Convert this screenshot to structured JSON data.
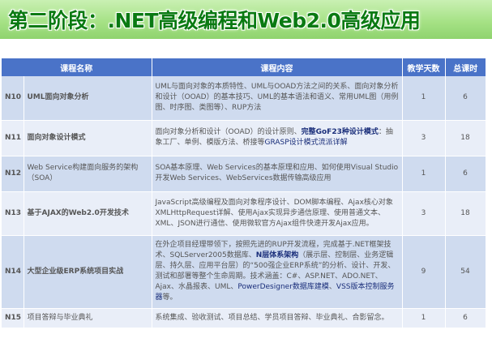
{
  "title": "第二阶段：.NET高级编程和Web2.0高级应用",
  "table": {
    "headers": [
      "课程名称",
      "课程内容",
      "教学天数",
      "总课时"
    ],
    "rows": [
      {
        "id": "N10",
        "name": "UML面向对象分析",
        "desc": "UML与面向对象的本质特性、UML与OOAD方法之间的关系、面向对象分析和设计（OOAD）的基本技巧、UML的基本语法和语义、常用UML图（用例图、时序图、类图等）、RUP方法",
        "days": "1",
        "hours": "6"
      },
      {
        "id": "N11",
        "name": "面向对象设计模式",
        "desc_a": "面向对象分析和设计（OOAD）的设计原则、",
        "desc_b": "完整GoF23种设计模式",
        "desc_c": "：抽象工厂、单例、模版方法、桥接等",
        "desc_d": "GRASP设计模式流派详解",
        "days": "3",
        "hours": "18"
      },
      {
        "id": "N12",
        "name": "Web Service构建面向服务的架构（SOA）",
        "desc": "SOA基本原理、Web Services的基本原理和应用、如何使用Visual Studio开发Web Services、WebServices数据传输高级应用",
        "days": "1",
        "hours": "6"
      },
      {
        "id": "N13",
        "name": "基于AJAX的Web2.0开发技术",
        "desc": "JavaScript高级编程及面向对象程序设计、DOM脚本编程、Ajax核心对象XMLHttpRequest详解、使用Ajax实现异步通信原理、使用普通文本、XML、JSON进行通信、使用微软官方Ajax组件快速开发Ajax应用。",
        "days": "3",
        "hours": "18"
      },
      {
        "id": "N14",
        "name": "大型企业级ERP系统项目实战",
        "desc_a": "在外企项目经理带领下，按照先进的RUP开发流程，完成基于.NET框架技术、SQLServer2005数据库、",
        "desc_b": "N层体系架构",
        "desc_c": "（展示层、控制层、业务逻辑层、持久层、应用平台层）的“500强企业ERP系统”的分析、设计、开发、测试和部署等整个生命周期。技术涵盖：C#、ASP.NET、ADO.NET、Ajax、水晶报表、UML、",
        "desc_d": "PowerDesigner数据库建模",
        "desc_e": "、",
        "desc_f": "VSS版本控制服务器",
        "desc_g": "等。",
        "days": "9",
        "hours": "54"
      },
      {
        "id": "N15",
        "name": "项目答辩与毕业典礼",
        "desc": "系统集成、验收测试、项目总结、学员项目答辩、毕业典礼、合影留念。",
        "days": "1",
        "hours": "6"
      }
    ]
  }
}
